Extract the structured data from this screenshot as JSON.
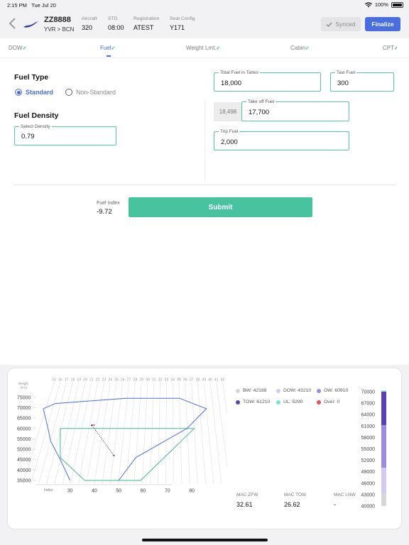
{
  "status_bar": {
    "time": "2:15 PM",
    "date": "Tue Jul 20",
    "battery": "100%"
  },
  "header": {
    "flight_number": "ZZ8888",
    "route": "YVR > BCN",
    "fields": [
      {
        "label": "Aircraft",
        "value": "320"
      },
      {
        "label": "STD",
        "value": "08:00"
      },
      {
        "label": "Registration",
        "value": "ATEST"
      },
      {
        "label": "Seat Config",
        "value": "Y171"
      }
    ],
    "synced_label": "Synced",
    "finalize_label": "Finalize"
  },
  "tabs": [
    {
      "label": "DOW",
      "active": false
    },
    {
      "label": "Fuel",
      "active": true
    },
    {
      "label": "Weight Lmt.",
      "active": false
    },
    {
      "label": "Cabin",
      "active": false
    },
    {
      "label": "CPT",
      "active": false
    }
  ],
  "fuel_type": {
    "title": "Fuel Type",
    "options": [
      {
        "label": "Standard",
        "selected": true
      },
      {
        "label": "Non-Standard",
        "selected": false
      }
    ]
  },
  "fuel_density": {
    "title": "Fuel Density",
    "field_label": "Select Density",
    "value": "0.79"
  },
  "fuel_fields": {
    "total_fuel": {
      "label": "Total Fuel in Tanks",
      "value": "18,000"
    },
    "taxi_fuel": {
      "label": "Taxi Fuel",
      "value": "300"
    },
    "takeoff_fuel": {
      "label": "Take off Fuel",
      "value": "17,700",
      "reference": "18,498"
    },
    "trip_fuel": {
      "label": "Trip Fuel",
      "value": "2,000"
    }
  },
  "fuel_index": {
    "label": "Fuel Index",
    "value": "-9.72"
  },
  "submit_label": "Submit",
  "chart_data": {
    "type": "scatter",
    "title": "",
    "ylabel": "Weight (KG)",
    "xlabel": "Index",
    "y_ticks": [
      "75000",
      "70000",
      "65000",
      "60000",
      "55000",
      "50000",
      "45000",
      "40000",
      "35000"
    ],
    "x_ticks": [
      "30",
      "40",
      "50",
      "60",
      "70",
      "80"
    ],
    "top_scale": [
      "15",
      "16",
      "17",
      "18",
      "19",
      "20",
      "21",
      "22",
      "23",
      "24",
      "25",
      "26",
      "27",
      "28",
      "29",
      "30",
      "31",
      "32",
      "33",
      "34",
      "35",
      "36",
      "37",
      "38",
      "39",
      "40",
      "41",
      "42"
    ],
    "envelope_color": "#4a6ee0",
    "limit_color": "#47b58f",
    "envelope": [
      [
        19,
        69500
      ],
      [
        24,
        72000
      ],
      [
        53,
        74500
      ],
      [
        75,
        74500
      ],
      [
        86,
        69500
      ],
      [
        78,
        60000
      ],
      [
        57,
        46000
      ],
      [
        50,
        35000
      ]
    ],
    "envelope_left": [
      [
        19,
        69500
      ],
      [
        21,
        60000
      ],
      [
        22,
        54000
      ],
      [
        26,
        45000
      ],
      [
        30,
        35000
      ]
    ],
    "limit_box": [
      [
        26,
        60000
      ],
      [
        81,
        60000
      ],
      [
        59,
        35000
      ],
      [
        36,
        35000
      ],
      [
        26,
        46000
      ],
      [
        26,
        60000
      ]
    ],
    "trim_line": [
      [
        39,
        61500
      ],
      [
        48,
        47000
      ]
    ],
    "legend": [
      {
        "label": "BW: 42188",
        "color": "#d6d6d6"
      },
      {
        "label": "DOW: 43210",
        "color": "#d4c9f0"
      },
      {
        "label": "OW: 60910",
        "color": "#9c8be0"
      },
      {
        "label": "TOW: 61210",
        "color": "#5b3fb8"
      },
      {
        "label": "UL: 5290",
        "color": "#7fe0cc"
      },
      {
        "label": "Over: 0",
        "color": "#e05555"
      }
    ],
    "bar_scale": [
      "70000",
      "67000",
      "64000",
      "61000",
      "58000",
      "55000",
      "52000",
      "49000",
      "46000",
      "43000",
      "40000"
    ],
    "bar_segments": [
      {
        "label": "UL",
        "from": 70000,
        "to": 70300,
        "color": "#7fe0cc"
      },
      {
        "label": "TOW",
        "from": 70000,
        "to": 61210,
        "color": "#5b3fb8"
      },
      {
        "label": "OW",
        "from": 61210,
        "to": 50000,
        "color": "#9c8be0"
      },
      {
        "label": "DOW",
        "from": 50000,
        "to": 43210,
        "color": "#d4c9f0"
      },
      {
        "label": "BW",
        "from": 43210,
        "to": 40000,
        "color": "#d6d6d6"
      }
    ],
    "mac": [
      {
        "label": "MAC ZFW",
        "value": "32.61"
      },
      {
        "label": "MAC TOW",
        "value": "26.62"
      },
      {
        "label": "MAC LNW",
        "value": "-"
      }
    ]
  }
}
